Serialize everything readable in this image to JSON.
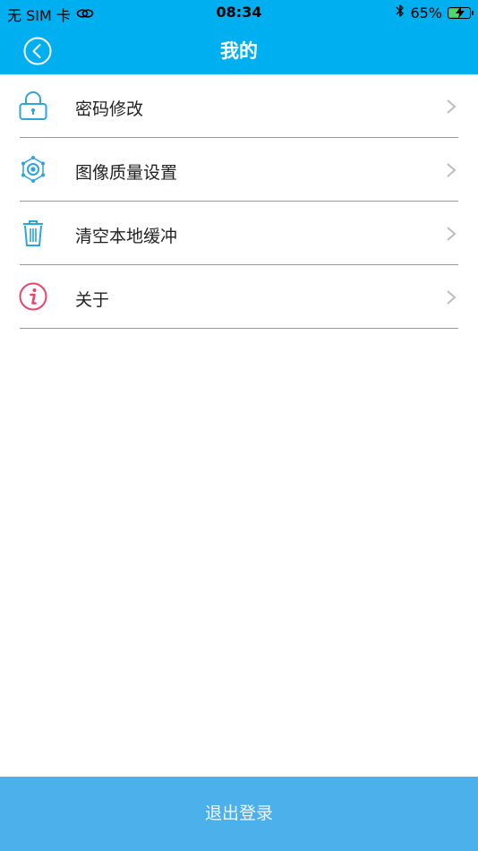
{
  "status_bar": {
    "carrier": "无 SIM 卡",
    "time": "08:34",
    "battery_percent": "65%",
    "battery_level": 0.65,
    "colors": {
      "battery_fill": "#4cd964"
    }
  },
  "nav": {
    "title": "我的",
    "back_icon": "back-circle-icon"
  },
  "menu": {
    "items": [
      {
        "label": "密码修改",
        "icon": "lock-icon",
        "icon_color": "#2aa5e0"
      },
      {
        "label": "图像质量设置",
        "icon": "image-quality-icon",
        "icon_color": "#2aa5e0"
      },
      {
        "label": "清空本地缓冲",
        "icon": "trash-icon",
        "icon_color": "#2aa5e0"
      },
      {
        "label": "关于",
        "icon": "info-icon",
        "icon_color": "#e8456a"
      }
    ]
  },
  "footer": {
    "logout_label": "退出登录"
  },
  "colors": {
    "header_bg": "#00aff0",
    "logout_bg": "#4cb1ea",
    "chevron": "#bdbdbd"
  }
}
